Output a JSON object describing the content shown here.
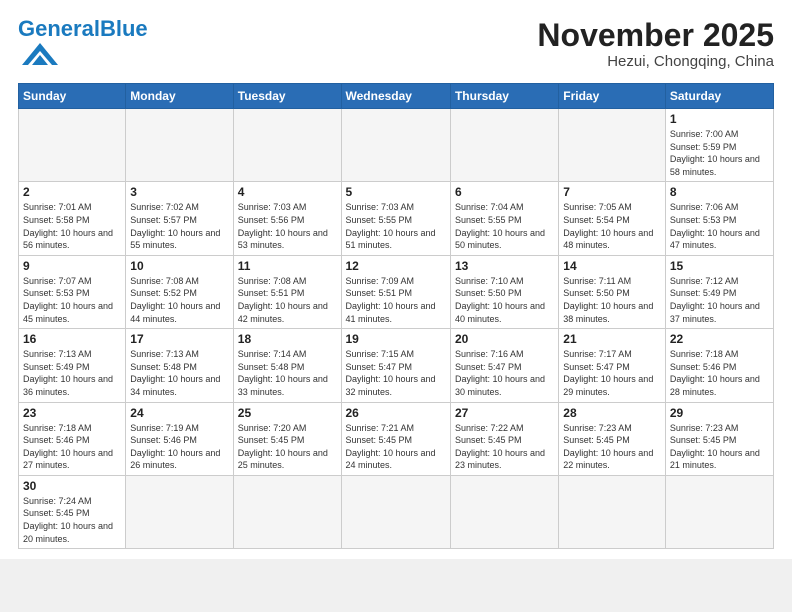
{
  "header": {
    "logo_general": "General",
    "logo_blue": "Blue",
    "month_title": "November 2025",
    "subtitle": "Hezui, Chongqing, China"
  },
  "weekdays": [
    "Sunday",
    "Monday",
    "Tuesday",
    "Wednesday",
    "Thursday",
    "Friday",
    "Saturday"
  ],
  "weeks": [
    [
      {
        "day": "",
        "info": ""
      },
      {
        "day": "",
        "info": ""
      },
      {
        "day": "",
        "info": ""
      },
      {
        "day": "",
        "info": ""
      },
      {
        "day": "",
        "info": ""
      },
      {
        "day": "",
        "info": ""
      },
      {
        "day": "1",
        "info": "Sunrise: 7:00 AM\nSunset: 5:59 PM\nDaylight: 10 hours and 58 minutes."
      }
    ],
    [
      {
        "day": "2",
        "info": "Sunrise: 7:01 AM\nSunset: 5:58 PM\nDaylight: 10 hours and 56 minutes."
      },
      {
        "day": "3",
        "info": "Sunrise: 7:02 AM\nSunset: 5:57 PM\nDaylight: 10 hours and 55 minutes."
      },
      {
        "day": "4",
        "info": "Sunrise: 7:03 AM\nSunset: 5:56 PM\nDaylight: 10 hours and 53 minutes."
      },
      {
        "day": "5",
        "info": "Sunrise: 7:03 AM\nSunset: 5:55 PM\nDaylight: 10 hours and 51 minutes."
      },
      {
        "day": "6",
        "info": "Sunrise: 7:04 AM\nSunset: 5:55 PM\nDaylight: 10 hours and 50 minutes."
      },
      {
        "day": "7",
        "info": "Sunrise: 7:05 AM\nSunset: 5:54 PM\nDaylight: 10 hours and 48 minutes."
      },
      {
        "day": "8",
        "info": "Sunrise: 7:06 AM\nSunset: 5:53 PM\nDaylight: 10 hours and 47 minutes."
      }
    ],
    [
      {
        "day": "9",
        "info": "Sunrise: 7:07 AM\nSunset: 5:53 PM\nDaylight: 10 hours and 45 minutes."
      },
      {
        "day": "10",
        "info": "Sunrise: 7:08 AM\nSunset: 5:52 PM\nDaylight: 10 hours and 44 minutes."
      },
      {
        "day": "11",
        "info": "Sunrise: 7:08 AM\nSunset: 5:51 PM\nDaylight: 10 hours and 42 minutes."
      },
      {
        "day": "12",
        "info": "Sunrise: 7:09 AM\nSunset: 5:51 PM\nDaylight: 10 hours and 41 minutes."
      },
      {
        "day": "13",
        "info": "Sunrise: 7:10 AM\nSunset: 5:50 PM\nDaylight: 10 hours and 40 minutes."
      },
      {
        "day": "14",
        "info": "Sunrise: 7:11 AM\nSunset: 5:50 PM\nDaylight: 10 hours and 38 minutes."
      },
      {
        "day": "15",
        "info": "Sunrise: 7:12 AM\nSunset: 5:49 PM\nDaylight: 10 hours and 37 minutes."
      }
    ],
    [
      {
        "day": "16",
        "info": "Sunrise: 7:13 AM\nSunset: 5:49 PM\nDaylight: 10 hours and 36 minutes."
      },
      {
        "day": "17",
        "info": "Sunrise: 7:13 AM\nSunset: 5:48 PM\nDaylight: 10 hours and 34 minutes."
      },
      {
        "day": "18",
        "info": "Sunrise: 7:14 AM\nSunset: 5:48 PM\nDaylight: 10 hours and 33 minutes."
      },
      {
        "day": "19",
        "info": "Sunrise: 7:15 AM\nSunset: 5:47 PM\nDaylight: 10 hours and 32 minutes."
      },
      {
        "day": "20",
        "info": "Sunrise: 7:16 AM\nSunset: 5:47 PM\nDaylight: 10 hours and 30 minutes."
      },
      {
        "day": "21",
        "info": "Sunrise: 7:17 AM\nSunset: 5:47 PM\nDaylight: 10 hours and 29 minutes."
      },
      {
        "day": "22",
        "info": "Sunrise: 7:18 AM\nSunset: 5:46 PM\nDaylight: 10 hours and 28 minutes."
      }
    ],
    [
      {
        "day": "23",
        "info": "Sunrise: 7:18 AM\nSunset: 5:46 PM\nDaylight: 10 hours and 27 minutes."
      },
      {
        "day": "24",
        "info": "Sunrise: 7:19 AM\nSunset: 5:46 PM\nDaylight: 10 hours and 26 minutes."
      },
      {
        "day": "25",
        "info": "Sunrise: 7:20 AM\nSunset: 5:45 PM\nDaylight: 10 hours and 25 minutes."
      },
      {
        "day": "26",
        "info": "Sunrise: 7:21 AM\nSunset: 5:45 PM\nDaylight: 10 hours and 24 minutes."
      },
      {
        "day": "27",
        "info": "Sunrise: 7:22 AM\nSunset: 5:45 PM\nDaylight: 10 hours and 23 minutes."
      },
      {
        "day": "28",
        "info": "Sunrise: 7:23 AM\nSunset: 5:45 PM\nDaylight: 10 hours and 22 minutes."
      },
      {
        "day": "29",
        "info": "Sunrise: 7:23 AM\nSunset: 5:45 PM\nDaylight: 10 hours and 21 minutes."
      }
    ],
    [
      {
        "day": "30",
        "info": "Sunrise: 7:24 AM\nSunset: 5:45 PM\nDaylight: 10 hours and 20 minutes."
      },
      {
        "day": "",
        "info": ""
      },
      {
        "day": "",
        "info": ""
      },
      {
        "day": "",
        "info": ""
      },
      {
        "day": "",
        "info": ""
      },
      {
        "day": "",
        "info": ""
      },
      {
        "day": "",
        "info": ""
      }
    ]
  ]
}
